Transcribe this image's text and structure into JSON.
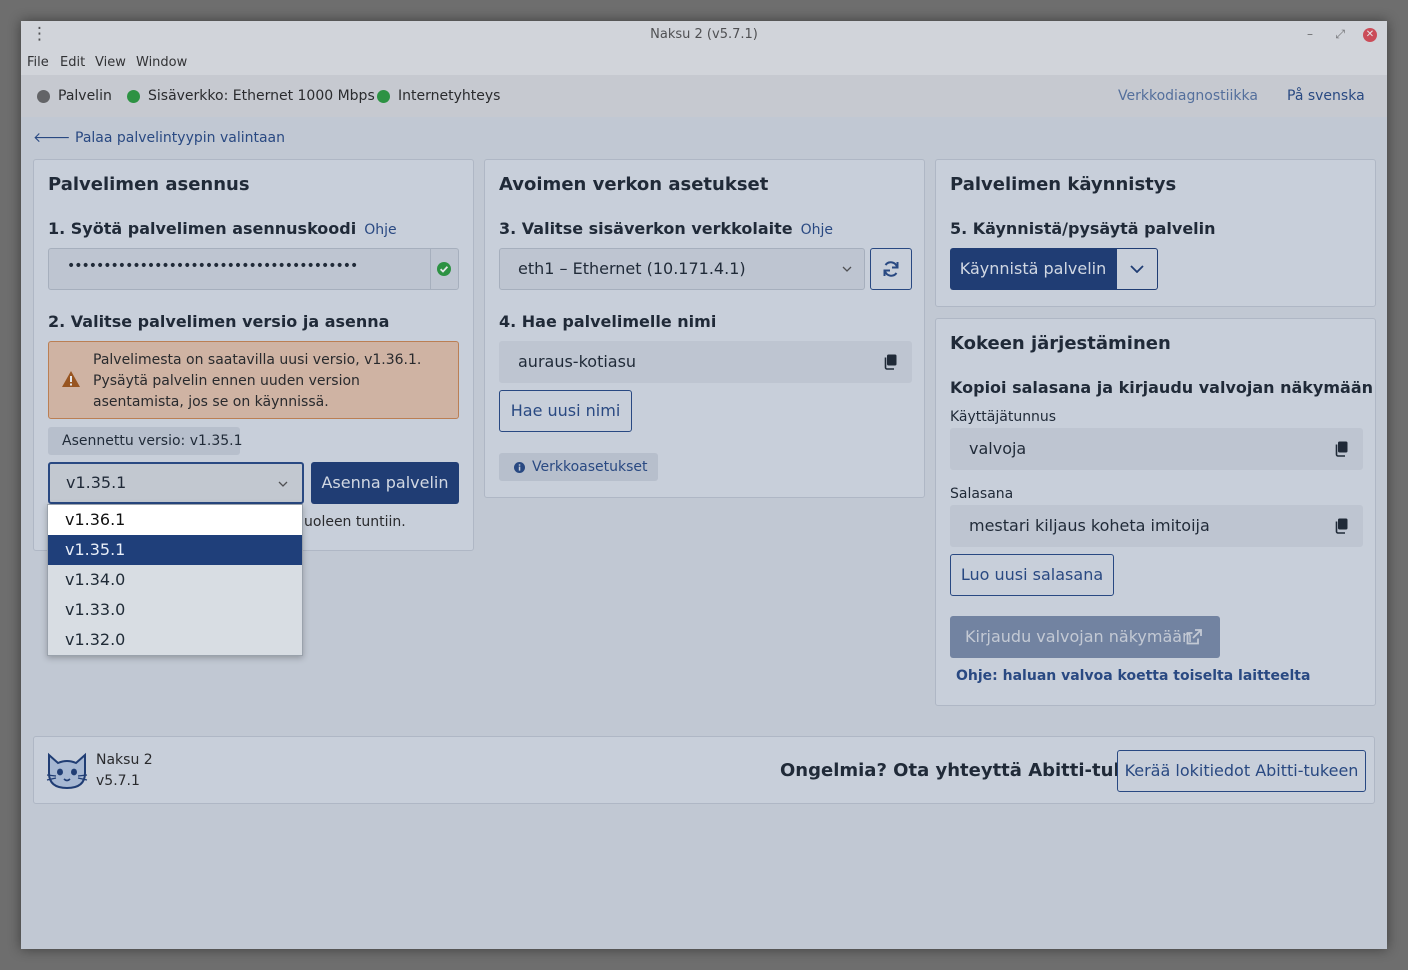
{
  "window": {
    "title": "Naksu 2 (v5.7.1)",
    "controls": {
      "minimize": "–",
      "maximize": "⤢",
      "close": "✕"
    }
  },
  "menu": [
    "File",
    "Edit",
    "View",
    "Window"
  ],
  "status": {
    "server": {
      "label": "Palvelin",
      "color": "#6b6b6b"
    },
    "lan": {
      "label": "Sisäverkko: Ethernet 1000 Mbps",
      "color": "#2ea043"
    },
    "internet": {
      "label": "Internetyhteys",
      "color": "#2ea043"
    },
    "diagnostics_link": "Verkkodiagnostiikka",
    "language_link": "På svenska"
  },
  "back_link": "Palaa palvelintyypin valintaan",
  "install_card": {
    "title": "Palvelimen asennus",
    "step1_label": "1. Syötä palvelimen asennuskoodi",
    "step1_help": "Ohje",
    "code_value": "••••••••••••••••••••••••••••••••••••••••",
    "step2_label": "2. Valitse palvelimen versio ja asenna",
    "warning": "Palvelimesta on saatavilla uusi versio, v1.36.1. Pysäytä palvelin ennen uuden version asentamista, jos se on käynnissä.",
    "installed_version": "Asennettu versio: v1.35.1",
    "selected_version": "v1.35.1",
    "install_button": "Asenna palvelin",
    "hint_fragment": "uoleen tuntiin.",
    "version_options": [
      "v1.36.1",
      "v1.35.1",
      "v1.34.0",
      "v1.33.0",
      "v1.32.0"
    ]
  },
  "network_card": {
    "title": "Avoimen verkon asetukset",
    "step3_label": "3. Valitse sisäverkon verkkolaite",
    "step3_help": "Ohje",
    "device_value": "eth1 – Ethernet (10.171.4.1)",
    "step4_label": "4. Hae palvelimelle nimi",
    "name_value": "auraus-kotiasu",
    "new_name_button": "Hae uusi nimi",
    "network_settings_button": "Verkkoasetukset"
  },
  "start_card": {
    "title": "Palvelimen käynnistys",
    "step5_label": "5. Käynnistä/pysäytä palvelin",
    "start_button": "Käynnistä palvelin"
  },
  "exam_card": {
    "title": "Kokeen järjestäminen",
    "subtitle": "Kopioi salasana ja kirjaudu valvojan näkymään",
    "username_label": "Käyttäjätunnus",
    "username_value": "valvoja",
    "password_label": "Salasana",
    "password_value": "mestari kiljaus koheta imitoija",
    "new_password_button": "Luo uusi salasana",
    "login_button": "Kirjaudu valvojan näkymään",
    "help_link": "Ohje: haluan valvoa koetta toiselta laitteelta"
  },
  "footer": {
    "app_name": "Naksu 2",
    "app_version": "v5.7.1",
    "problem_text": "Ongelmia? Ota yhteyttä Abitti-tukeen",
    "collect_logs_button": "Kerää lokitiedot Abitti-tukeen"
  }
}
